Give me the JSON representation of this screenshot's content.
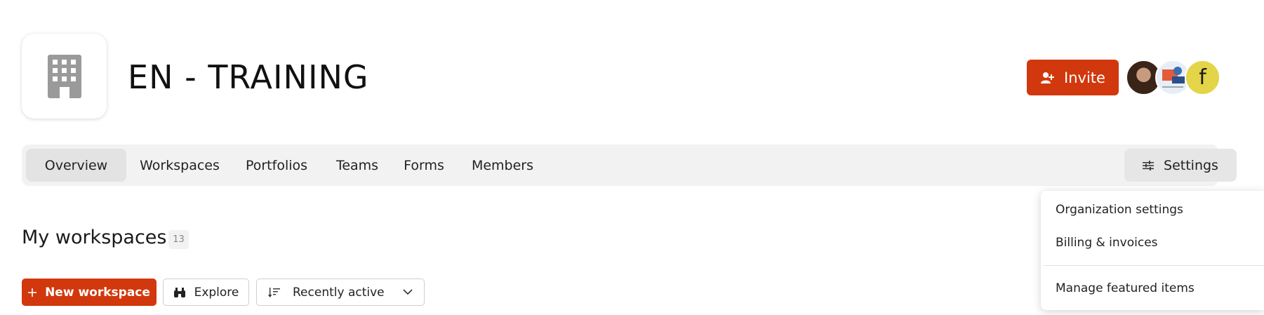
{
  "org": {
    "title": "EN - TRAINING",
    "logo_icon": "building-icon"
  },
  "header": {
    "invite_label": "Invite",
    "avatars": [
      {
        "kind": "photo",
        "name": "user-avatar-photo"
      },
      {
        "kind": "illustration",
        "name": "user-avatar-illustration"
      },
      {
        "kind": "initial",
        "initial": "f"
      }
    ]
  },
  "nav": {
    "tabs": [
      {
        "label": "Overview",
        "active": true
      },
      {
        "label": "Workspaces",
        "active": false
      },
      {
        "label": "Portfolios",
        "active": false
      },
      {
        "label": "Teams",
        "active": false
      },
      {
        "label": "Forms",
        "active": false
      },
      {
        "label": "Members",
        "active": false
      }
    ],
    "settings_label": "Settings"
  },
  "section": {
    "title": "My workspaces",
    "count": "13"
  },
  "actions": {
    "new_workspace_label": "New workspace",
    "explore_label": "Explore",
    "sort_selected": "Recently active"
  },
  "settings_menu": {
    "items": [
      "Organization settings",
      "Billing & invoices",
      "Manage featured items"
    ]
  },
  "colors": {
    "accent": "#d2380d",
    "nav_bg": "#f2f2f2",
    "avatar_yellow": "#e4d447"
  }
}
